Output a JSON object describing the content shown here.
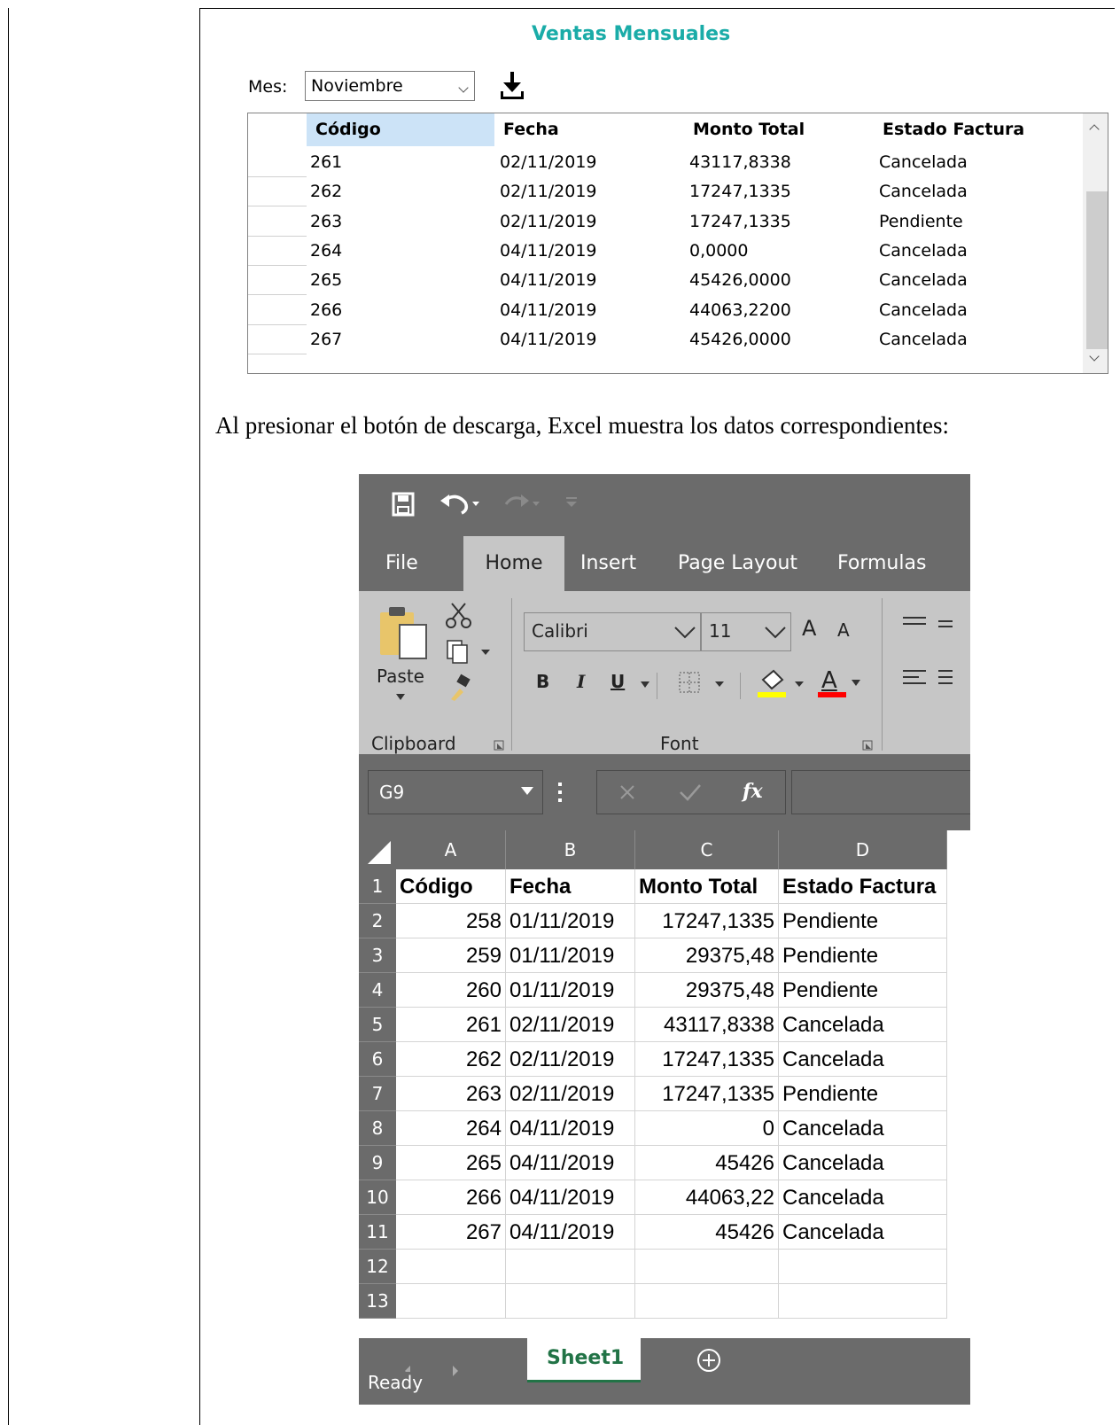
{
  "app": {
    "title": "Ventas Mensuales",
    "mes_label": "Mes:",
    "mes_value": "Noviembre",
    "download_icon": "download-icon",
    "grid": {
      "columns": [
        "Código",
        "Fecha",
        "Monto Total",
        "Estado Factura"
      ],
      "rows": [
        [
          "261",
          "02/11/2019",
          "43117,8338",
          "Cancelada"
        ],
        [
          "262",
          "02/11/2019",
          "17247,1335",
          "Cancelada"
        ],
        [
          "263",
          "02/11/2019",
          "17247,1335",
          "Pendiente"
        ],
        [
          "264",
          "04/11/2019",
          "0,0000",
          "Cancelada"
        ],
        [
          "265",
          "04/11/2019",
          "45426,0000",
          "Cancelada"
        ],
        [
          "266",
          "04/11/2019",
          "44063,2200",
          "Cancelada"
        ],
        [
          "267",
          "04/11/2019",
          "45426,0000",
          "Cancelada"
        ]
      ]
    }
  },
  "paragraph": "Al presionar el botón de descarga, Excel muestra los datos correspondientes:",
  "excel": {
    "tabs": [
      "File",
      "Home",
      "Insert",
      "Page Layout",
      "Formulas"
    ],
    "active_tab": "Home",
    "ribbon": {
      "paste_label": "Paste",
      "clipboard_label": "Clipboard",
      "font_group_label": "Font",
      "font_name": "Calibri",
      "font_size": "11",
      "bold": "B",
      "italic": "I",
      "underline": "U",
      "grow_font": "A",
      "shrink_font": "A",
      "font_color": "A"
    },
    "name_box": "G9",
    "fx_label": "fx",
    "column_headers": [
      "A",
      "B",
      "C",
      "D"
    ],
    "row_numbers": [
      "1",
      "2",
      "3",
      "4",
      "5",
      "6",
      "7",
      "8",
      "9",
      "10",
      "11",
      "12",
      "13"
    ],
    "header_row": [
      "Código",
      "Fecha",
      "Monto Total",
      "Estado Factura"
    ],
    "rows": [
      [
        "258",
        "01/11/2019",
        "17247,1335",
        "Pendiente"
      ],
      [
        "259",
        "01/11/2019",
        "29375,48",
        "Pendiente"
      ],
      [
        "260",
        "01/11/2019",
        "29375,48",
        "Pendiente"
      ],
      [
        "261",
        "02/11/2019",
        "43117,8338",
        "Cancelada"
      ],
      [
        "262",
        "02/11/2019",
        "17247,1335",
        "Cancelada"
      ],
      [
        "263",
        "02/11/2019",
        "17247,1335",
        "Pendiente"
      ],
      [
        "264",
        "04/11/2019",
        "0",
        "Cancelada"
      ],
      [
        "265",
        "04/11/2019",
        "45426",
        "Cancelada"
      ],
      [
        "266",
        "04/11/2019",
        "44063,22",
        "Cancelada"
      ],
      [
        "267",
        "04/11/2019",
        "45426",
        "Cancelada"
      ]
    ],
    "sheet_tab": "Sheet1",
    "status": "Ready",
    "colors": {
      "sheet_tab_text": "#217346",
      "ribbon_bg": "#c6c6c6",
      "chrome_bg": "#6b6b6b",
      "title_accent": "#1aaca8"
    }
  }
}
